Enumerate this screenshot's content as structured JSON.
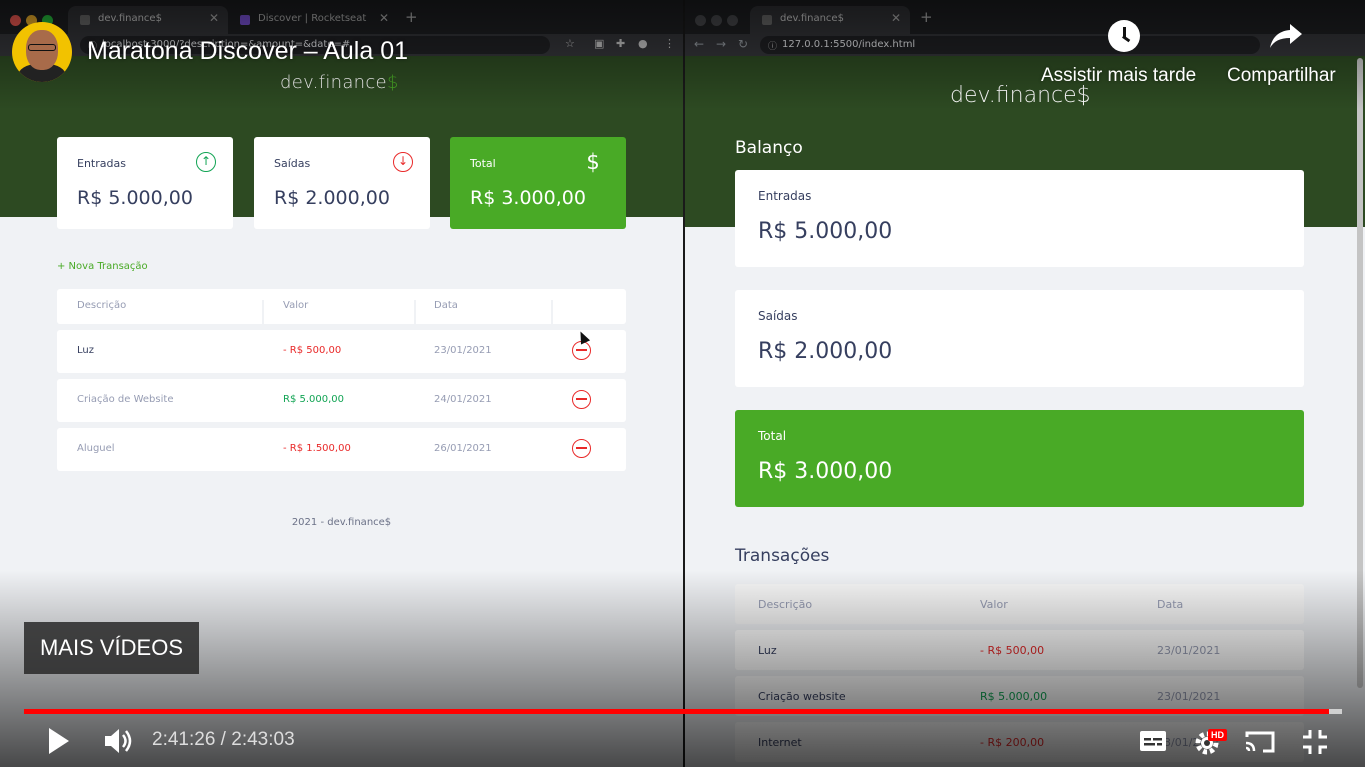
{
  "video": {
    "title": "Maratona Discover – Aula 01",
    "watch_later_label": "Assistir mais tarde",
    "share_label": "Compartilhar",
    "more_videos_label": "MAIS VÍDEOS",
    "time_current": "2:41:26",
    "time_separator": " / ",
    "time_total": "2:43:03",
    "progress_fraction": 0.99,
    "hd_badge": "HD",
    "accent_color": "#ff0000"
  },
  "left_browser": {
    "tabs": [
      {
        "label": "dev.finance$"
      },
      {
        "label": "Discover | Rocketseat"
      }
    ],
    "url": "localhost:3000/?description=&amount=&date=#",
    "app": {
      "logo_main": "dev.finance",
      "logo_suffix": "$",
      "cards": {
        "income": {
          "label": "Entradas",
          "value": "R$ 5.000,00"
        },
        "expense": {
          "label": "Saídas",
          "value": "R$ 2.000,00"
        },
        "total": {
          "label": "Total",
          "value": "R$ 3.000,00",
          "icon_glyph": "$"
        }
      },
      "new_transaction_link": "+ Nova Transação",
      "table_headers": [
        "Descrição",
        "Valor",
        "Data"
      ],
      "transactions": [
        {
          "description": "Luz",
          "amount": "- R$ 500,00",
          "date": "23/01/2021"
        },
        {
          "description": "Criação de Website",
          "amount": "R$ 5.000,00",
          "date": "24/01/2021"
        },
        {
          "description": "Aluguel",
          "amount": "- R$ 1.500,00",
          "date": "26/01/2021"
        }
      ],
      "footer": "2021 - dev.finance$"
    }
  },
  "right_browser": {
    "tabs": [
      {
        "label": "dev.finance$"
      }
    ],
    "url": "127.0.0.1:5500/index.html",
    "app": {
      "logo": "dev.finance$",
      "balance_title": "Balanço",
      "cards": {
        "income": {
          "label": "Entradas",
          "value": "R$ 5.000,00"
        },
        "expense": {
          "label": "Saídas",
          "value": "R$ 2.000,00"
        },
        "total": {
          "label": "Total",
          "value": "R$ 3.000,00"
        }
      },
      "transactions_title": "Transações",
      "table_headers": [
        "Descrição",
        "Valor",
        "Data"
      ],
      "transactions": [
        {
          "description": "Luz",
          "amount": "- R$ 500,00",
          "date": "23/01/2021"
        },
        {
          "description": "Criação website",
          "amount": "R$ 5.000,00",
          "date": "23/01/2021"
        },
        {
          "description": "Internet",
          "amount": "- R$ 200,00",
          "date": "23/01/2021"
        }
      ]
    }
  },
  "colors": {
    "header_green": "#2d4a22",
    "brand_green": "#49aa26",
    "income_green": "#12a454",
    "expense_red": "#e92929",
    "text_dark": "#363f5f",
    "background": "#f0f2f5"
  }
}
